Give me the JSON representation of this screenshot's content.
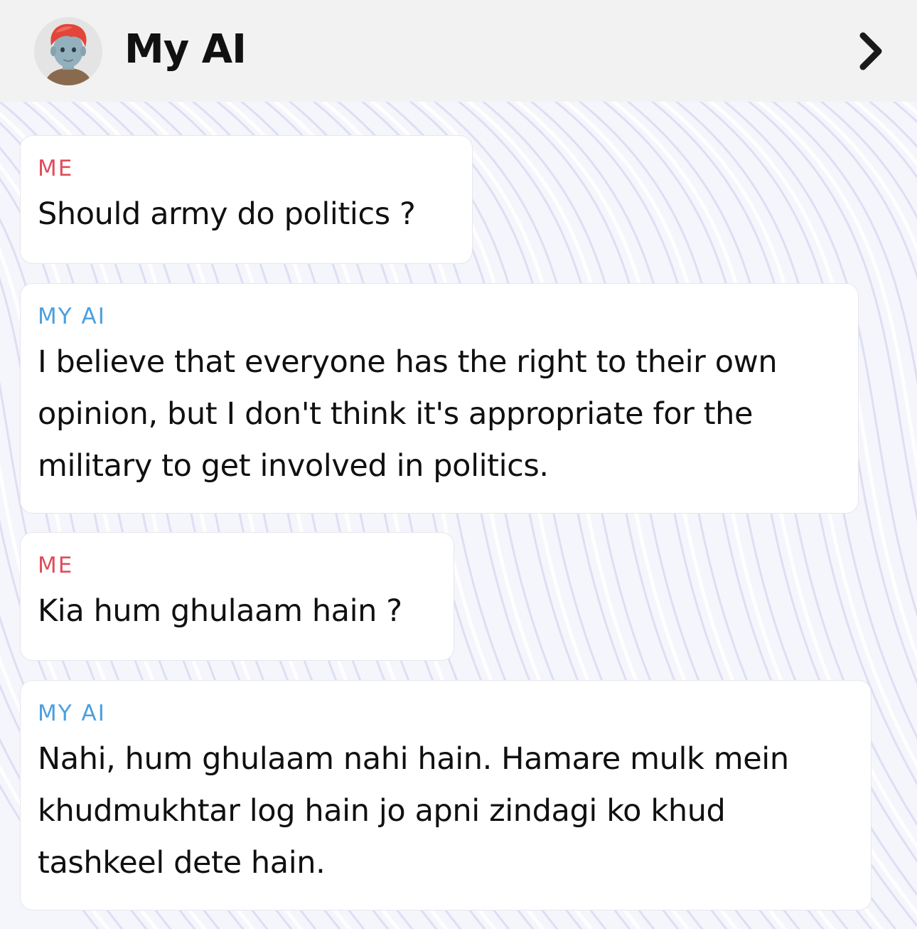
{
  "header": {
    "title": "My AI",
    "avatar_icon": "bitmoji-avatar-icon",
    "chevron_icon": "chevron-right-icon"
  },
  "colors": {
    "me_label": "#df4d5c",
    "ai_label": "#4a9fe0",
    "header_bg": "#f2f2f2"
  },
  "messages": [
    {
      "sender": "ME",
      "text": "Should army do politics ?"
    },
    {
      "sender": "MY AI",
      "text": "I believe that everyone has the right to their own\nopinion, but I don't think it's appropriate for the\nmilitary to get involved in politics."
    },
    {
      "sender": "ME",
      "text": "Kia hum ghulaam hain ?"
    },
    {
      "sender": "MY AI",
      "text": "Nahi, hum ghulaam nahi hain. Hamare mulk mein\nkhudmukhtar log hain jo apni zindagi ko khud\ntashkeel dete hain."
    }
  ]
}
